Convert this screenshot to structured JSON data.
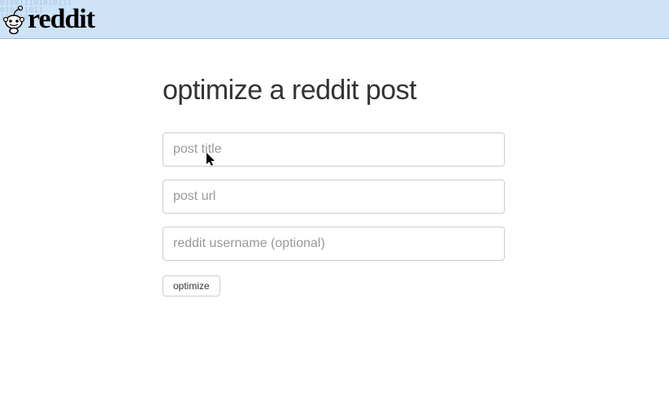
{
  "header": {
    "logo_text": "reddit",
    "binary_lines": [
      "010011101010111",
      "010101011",
      "111010"
    ]
  },
  "main": {
    "title": "optimize a reddit post",
    "fields": {
      "title_placeholder": "post title",
      "url_placeholder": "post url",
      "username_placeholder": "reddit username (optional)"
    },
    "submit_label": "optimize"
  }
}
